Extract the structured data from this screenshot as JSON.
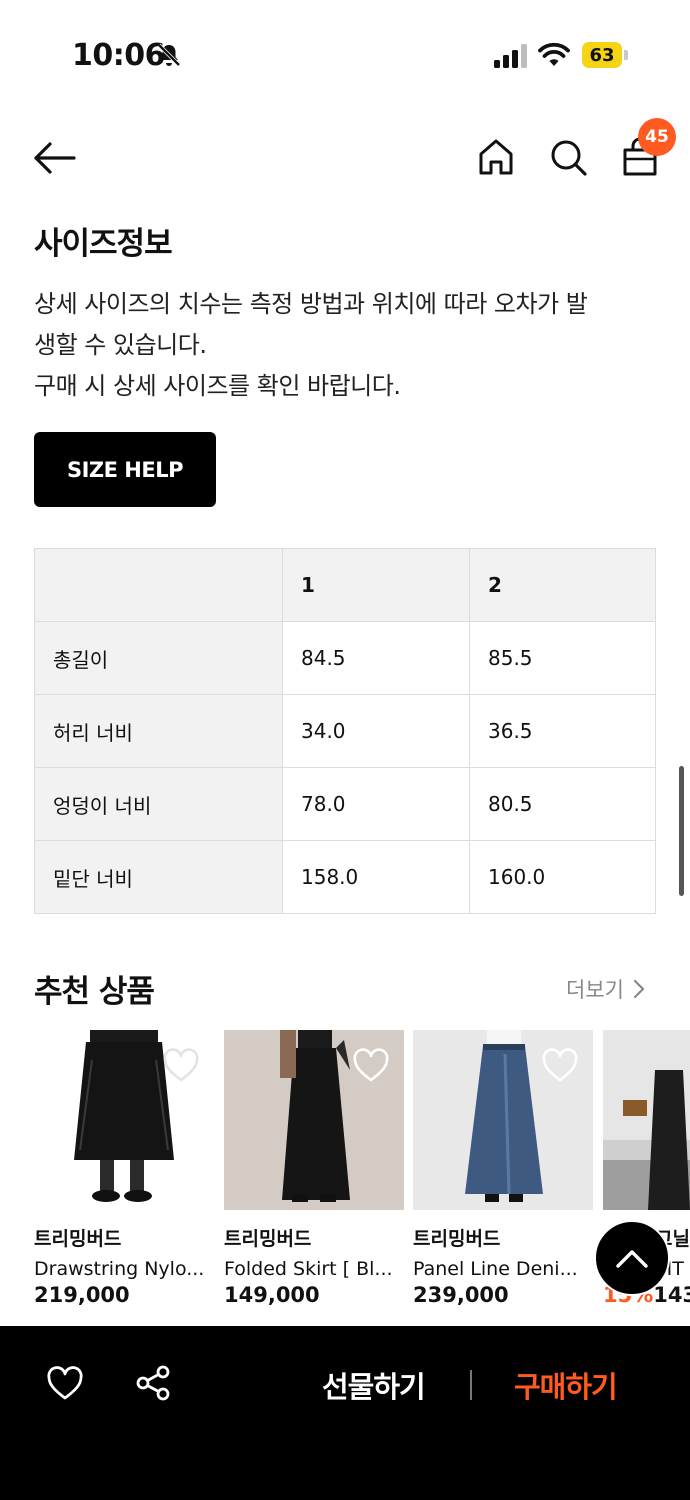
{
  "status": {
    "time": "10:06",
    "battery": "63"
  },
  "nav": {
    "cart_count": "45"
  },
  "size_info": {
    "title": "사이즈정보",
    "description": [
      "상세 사이즈의 치수는 측정 방법과 위치에 따라 오차가 발",
      "생할 수 있습니다.",
      "구매 시 상세 사이즈를 확인 바랍니다."
    ],
    "help_button": "SIZE HELP",
    "table": {
      "headers": [
        "",
        "1",
        "2"
      ],
      "rows": [
        [
          "총길이",
          "84.5",
          "85.5"
        ],
        [
          "허리 너비",
          "34.0",
          "36.5"
        ],
        [
          "엉덩이 너비",
          "78.0",
          "80.5"
        ],
        [
          "밑단 너비",
          "158.0",
          "160.0"
        ]
      ]
    }
  },
  "recommended": {
    "title": "추천 상품",
    "more": "더보기",
    "items": [
      {
        "brand": "트리밍버드",
        "name": "Drawstring Nylo...",
        "price": "219,000",
        "discount": ""
      },
      {
        "brand": "트리밍버드",
        "name": "Folded Skirt [ Bl...",
        "price": "149,000",
        "discount": ""
      },
      {
        "brand": "트리밍버드",
        "name": "Panel Line Deni...",
        "price": "239,000",
        "discount": ""
      },
      {
        "brand": "고닐",
        "name": "TIT",
        "price": "143",
        "discount": "15%"
      }
    ]
  },
  "bottom_bar": {
    "gift": "선물하기",
    "buy": "구매하기"
  },
  "colors": {
    "accent": "#ff5a1f",
    "battery": "#f5d315"
  }
}
